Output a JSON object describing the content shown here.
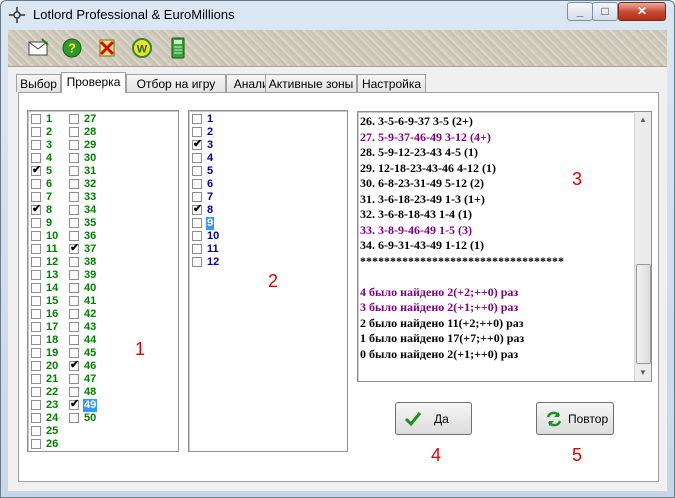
{
  "window": {
    "title": "Lotlord Professional & EuroMillions"
  },
  "toolbar": {
    "icons": [
      "envelope-icon",
      "help-icon",
      "cross-icon",
      "w-icon",
      "calculator-icon"
    ]
  },
  "tabs": [
    "Выбор",
    "Проверка",
    "Отбор на игру",
    "Анализ",
    "Активные зоны",
    "Настройка"
  ],
  "active_tab": "Проверка",
  "numbers_main": {
    "col1": [
      {
        "n": "1",
        "checked": false
      },
      {
        "n": "2",
        "checked": false
      },
      {
        "n": "3",
        "checked": false
      },
      {
        "n": "4",
        "checked": false
      },
      {
        "n": "5",
        "checked": true
      },
      {
        "n": "6",
        "checked": false
      },
      {
        "n": "7",
        "checked": false
      },
      {
        "n": "8",
        "checked": true
      },
      {
        "n": "9",
        "checked": false
      },
      {
        "n": "10",
        "checked": false
      },
      {
        "n": "11",
        "checked": false
      },
      {
        "n": "12",
        "checked": false
      },
      {
        "n": "13",
        "checked": false
      },
      {
        "n": "14",
        "checked": false
      },
      {
        "n": "15",
        "checked": false
      },
      {
        "n": "16",
        "checked": false
      },
      {
        "n": "17",
        "checked": false
      },
      {
        "n": "18",
        "checked": false
      },
      {
        "n": "19",
        "checked": false
      },
      {
        "n": "20",
        "checked": false
      },
      {
        "n": "21",
        "checked": false
      },
      {
        "n": "22",
        "checked": false
      },
      {
        "n": "23",
        "checked": false
      },
      {
        "n": "24",
        "checked": false
      },
      {
        "n": "25",
        "checked": false
      },
      {
        "n": "26",
        "checked": false
      }
    ],
    "col2": [
      {
        "n": "27",
        "checked": false
      },
      {
        "n": "28",
        "checked": false
      },
      {
        "n": "29",
        "checked": false
      },
      {
        "n": "30",
        "checked": false
      },
      {
        "n": "31",
        "checked": false
      },
      {
        "n": "32",
        "checked": false
      },
      {
        "n": "33",
        "checked": false
      },
      {
        "n": "34",
        "checked": false
      },
      {
        "n": "35",
        "checked": false
      },
      {
        "n": "36",
        "checked": false
      },
      {
        "n": "37",
        "checked": true
      },
      {
        "n": "38",
        "checked": false
      },
      {
        "n": "39",
        "checked": false
      },
      {
        "n": "40",
        "checked": false
      },
      {
        "n": "41",
        "checked": false
      },
      {
        "n": "42",
        "checked": false
      },
      {
        "n": "43",
        "checked": false
      },
      {
        "n": "44",
        "checked": false
      },
      {
        "n": "45",
        "checked": false
      },
      {
        "n": "46",
        "checked": true
      },
      {
        "n": "47",
        "checked": false
      },
      {
        "n": "48",
        "checked": false
      },
      {
        "n": "49",
        "checked": true,
        "selected": true
      },
      {
        "n": "50",
        "checked": false
      }
    ]
  },
  "numbers_stars": [
    {
      "n": "1",
      "checked": false
    },
    {
      "n": "2",
      "checked": false
    },
    {
      "n": "3",
      "checked": true
    },
    {
      "n": "4",
      "checked": false
    },
    {
      "n": "5",
      "checked": false
    },
    {
      "n": "6",
      "checked": false
    },
    {
      "n": "7",
      "checked": false
    },
    {
      "n": "8",
      "checked": true
    },
    {
      "n": "9",
      "checked": false,
      "selected": true
    },
    {
      "n": "10",
      "checked": false
    },
    {
      "n": "11",
      "checked": false
    },
    {
      "n": "12",
      "checked": false
    }
  ],
  "results": [
    {
      "text": "26. 3-5-6-9-37  3-5  (2+)",
      "color": "black"
    },
    {
      "text": "27. 5-9-37-46-49  3-12  (4+)",
      "color": "purple"
    },
    {
      "text": "28. 5-9-12-23-43  4-5  (1)",
      "color": "black"
    },
    {
      "text": "29. 12-18-23-43-46  4-12  (1)",
      "color": "black"
    },
    {
      "text": "30. 6-8-23-31-49  5-12  (2)",
      "color": "black"
    },
    {
      "text": "31. 3-6-18-23-49  1-3  (1+)",
      "color": "black"
    },
    {
      "text": "32. 3-6-8-18-43  1-4  (1)",
      "color": "black"
    },
    {
      "text": "33. 3-8-9-46-49  1-5  (3)",
      "color": "purple"
    },
    {
      "text": "34. 6-9-31-43-49  1-12  (1)",
      "color": "black"
    },
    {
      "text": " **********************************",
      "color": "black"
    },
    {
      "text": "",
      "color": "black"
    },
    {
      "text": "  4 было найдено 2(+2;++0) раз",
      "color": "purple"
    },
    {
      "text": "  3 было найдено 2(+1;++0) раз",
      "color": "purple"
    },
    {
      "text": "  2 было найдено 11(+2;++0) раз",
      "color": "black"
    },
    {
      "text": "  1 было найдено 17(+7;++0) раз",
      "color": "black"
    },
    {
      "text": "  0 было найдено 2(+1;++0) раз",
      "color": "black"
    }
  ],
  "buttons": {
    "ok_label": "Да",
    "retry_label": "Повтор"
  },
  "annotations": {
    "a1": "1",
    "a2": "2",
    "a3": "3",
    "a4": "4",
    "a5": "5"
  },
  "colors": {
    "main_numbers": "#008000",
    "star_numbers": "#00008b",
    "highlight": "#3399ff",
    "purple": "#800080",
    "annotation": "#e00000"
  }
}
